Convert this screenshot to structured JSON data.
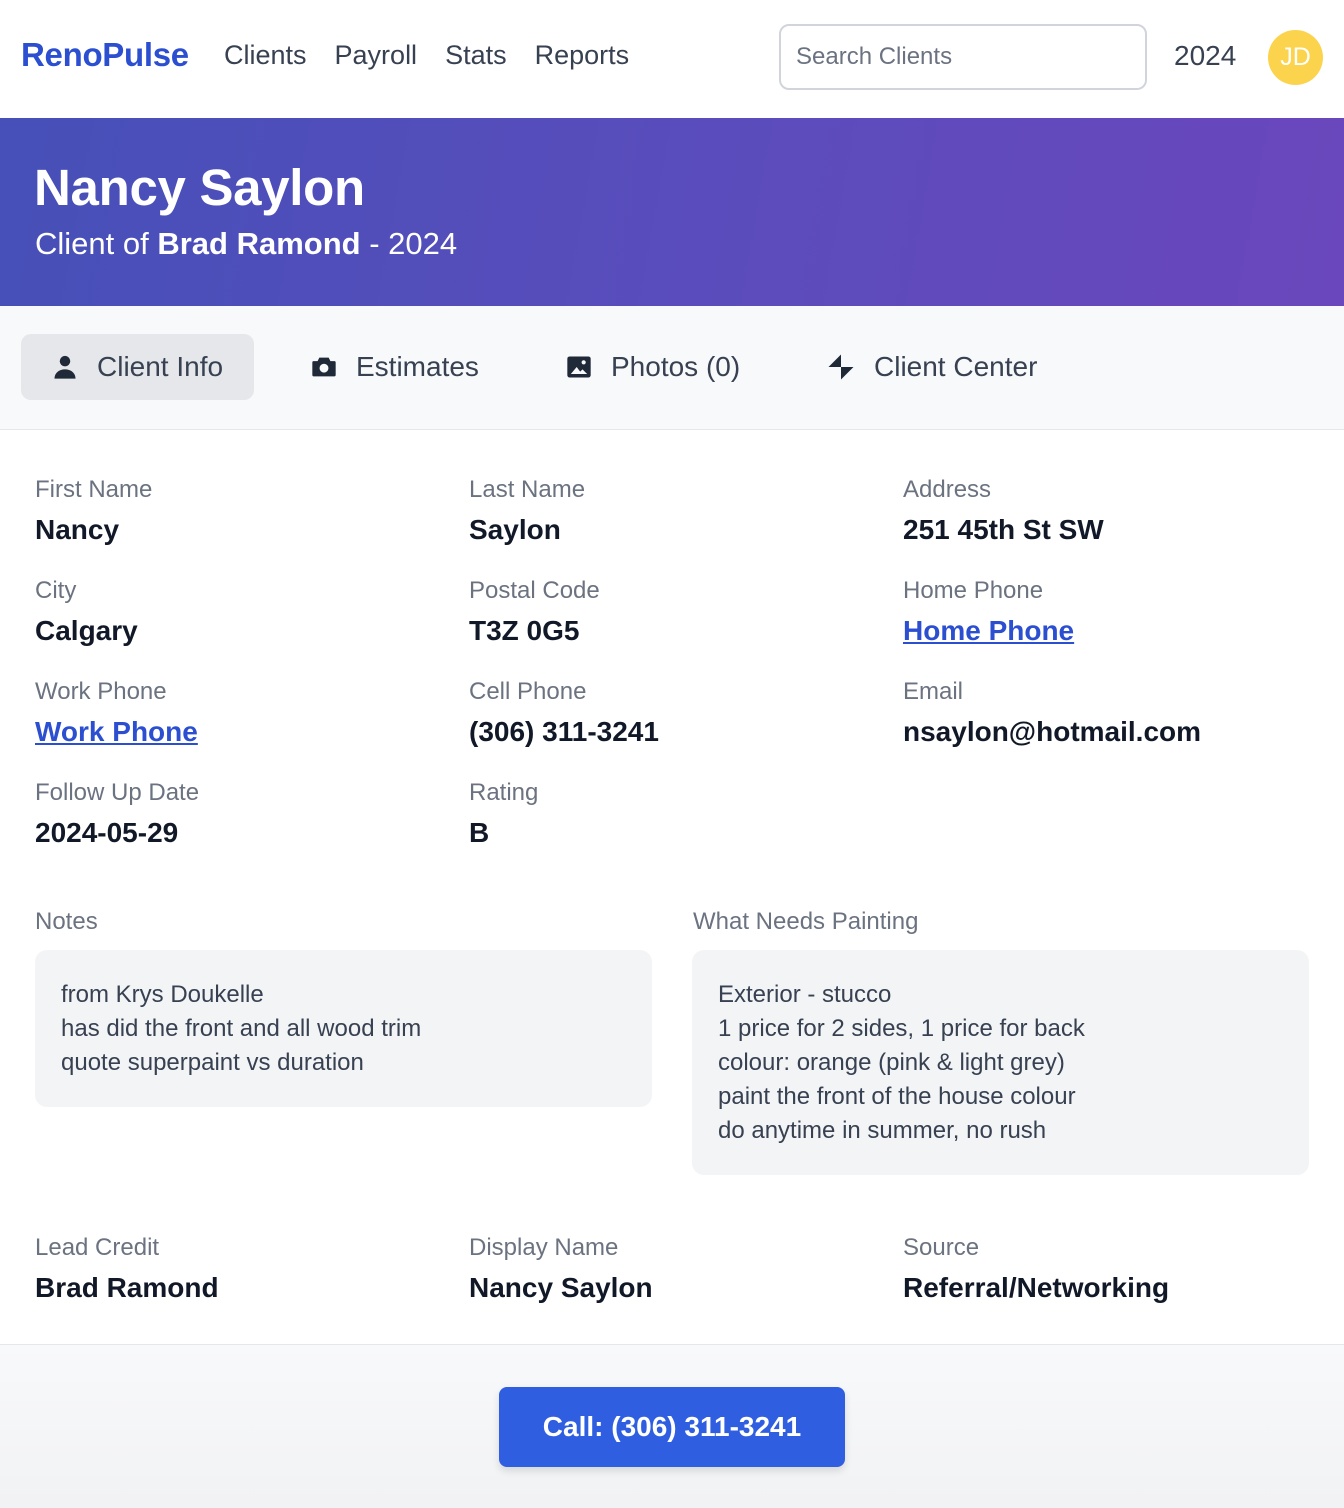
{
  "nav": {
    "brand": "RenoPulse",
    "links": [
      "Clients",
      "Payroll",
      "Stats",
      "Reports"
    ],
    "search_placeholder": "Search Clients",
    "year": "2024",
    "avatar_initials": "JD"
  },
  "header": {
    "client_name": "Nancy Saylon",
    "subtitle_prefix": "Client of ",
    "owner": "Brad Ramond",
    "subtitle_suffix": " - 2024"
  },
  "tabs": [
    {
      "label": "Client Info",
      "icon": "person-icon",
      "active": true
    },
    {
      "label": "Estimates",
      "icon": "camera-icon",
      "active": false
    },
    {
      "label": "Photos (0)",
      "icon": "image-icon",
      "active": false
    },
    {
      "label": "Client Center",
      "icon": "pinwheel-icon",
      "active": false
    }
  ],
  "fields": {
    "first_name": {
      "label": "First Name",
      "value": "Nancy"
    },
    "last_name": {
      "label": "Last Name",
      "value": "Saylon"
    },
    "address": {
      "label": "Address",
      "value": "251 45th St SW"
    },
    "city": {
      "label": "City",
      "value": "Calgary"
    },
    "postal_code": {
      "label": "Postal Code",
      "value": "T3Z 0G5"
    },
    "home_phone": {
      "label": "Home Phone",
      "value": "Home Phone"
    },
    "work_phone": {
      "label": "Work Phone",
      "value": "Work Phone"
    },
    "cell_phone": {
      "label": "Cell Phone",
      "value": "(306) 311-3241"
    },
    "email": {
      "label": "Email",
      "value": "nsaylon@hotmail.com"
    },
    "follow_up": {
      "label": "Follow Up Date",
      "value": "2024-05-29"
    },
    "rating": {
      "label": "Rating",
      "value": "B"
    },
    "lead_credit": {
      "label": "Lead Credit",
      "value": "Brad Ramond"
    },
    "display_name": {
      "label": "Display Name",
      "value": "Nancy Saylon"
    },
    "source": {
      "label": "Source",
      "value": "Referral/Networking"
    }
  },
  "notes": {
    "label": "Notes",
    "lines": [
      "from Krys Doukelle",
      "has did the front and all wood trim",
      "quote superpaint vs duration"
    ]
  },
  "painting": {
    "label": "What Needs Painting",
    "lines": [
      "Exterior - stucco",
      "1 price for 2 sides, 1 price for back",
      "colour: orange (pink & light grey)",
      "paint the front of the house colour",
      "do anytime in summer, no rush"
    ]
  },
  "call_button": "Call: (306) 311-3241",
  "colors": {
    "brand": "#2b4fd0",
    "banner_start": "#4650b8",
    "banner_end": "#6a47bc",
    "button": "#2f5fe0",
    "avatar": "#fcd34d"
  }
}
